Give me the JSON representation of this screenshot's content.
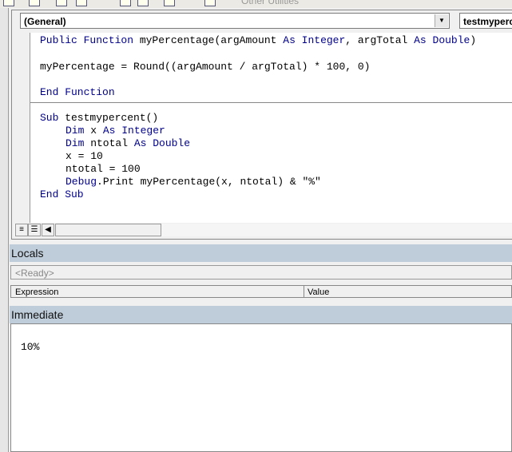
{
  "toolbar": {
    "partial_label": "Other Utilities"
  },
  "code_window": {
    "object_combo": "(General)",
    "procedure_combo": "testmyperc",
    "lines": [
      {
        "kw1": "Public Function",
        "rest1": " myPercentage(argAmount ",
        "kw2": "As Integer",
        ", ": "",
        "rest2": ", argTotal ",
        "kw3": "As Double",
        "rest3": ")"
      },
      {
        "text": "myPercentage = Round((argAmount / argTotal) * 100, 0)"
      },
      {
        "kw": "End Function"
      },
      {
        "kw": "Sub",
        "rest": " testmypercent()"
      },
      {
        "kw": "Dim",
        "mid": " x ",
        "kw2": "As Integer"
      },
      {
        "kw": "Dim",
        "mid": " ntotal ",
        "kw2": "As Double"
      },
      {
        "text": "x = 10"
      },
      {
        "text": "ntotal = 100"
      },
      {
        "kw": "Debug",
        "rest": ".Print myPercentage(x, ntotal) & \"%\""
      },
      {
        "kw": "End Sub"
      }
    ]
  },
  "locals": {
    "title": "Locals",
    "status": "<Ready>",
    "columns": [
      "Expression",
      "Value"
    ]
  },
  "immediate": {
    "title": "Immediate",
    "output": "10%"
  }
}
